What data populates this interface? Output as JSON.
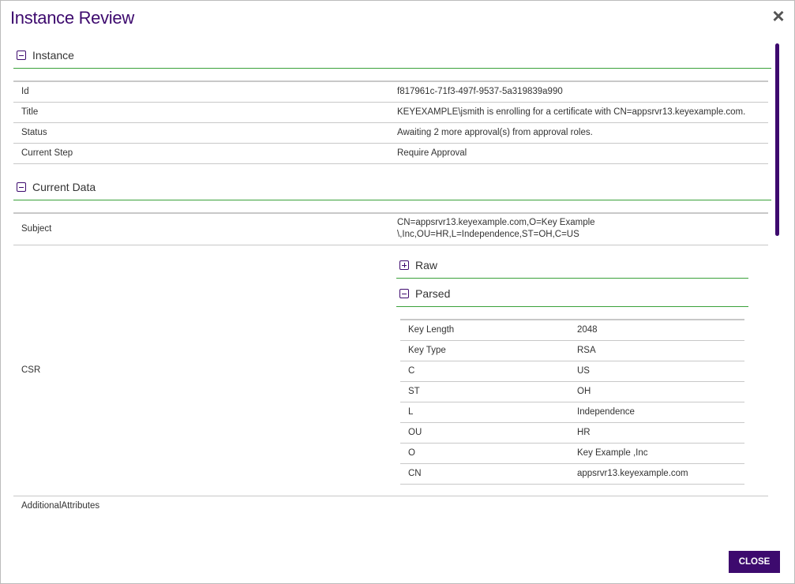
{
  "dialog": {
    "title": "Instance Review",
    "close_icon": "close-icon",
    "close_button": "CLOSE"
  },
  "instance": {
    "header": "Instance",
    "rows": [
      {
        "label": "Id",
        "value": "f817961c-71f3-497f-9537-5a319839a990"
      },
      {
        "label": "Title",
        "value": "KEYEXAMPLE\\jsmith is enrolling for a certificate with CN=appsrvr13.keyexample.com."
      },
      {
        "label": "Status",
        "value": "Awaiting 2 more approval(s) from approval roles."
      },
      {
        "label": "Current Step",
        "value": "Require Approval"
      }
    ]
  },
  "current_data": {
    "header": "Current Data",
    "subject": {
      "label": "Subject",
      "value_line1": "CN=appsrvr13.keyexample.com,O=Key Example",
      "value_line2": "\\,Inc,OU=HR,L=Independence,ST=OH,C=US"
    },
    "csr": {
      "label": "CSR",
      "raw_header": "Raw",
      "parsed_header": "Parsed",
      "parsed_rows": [
        {
          "label": "Key Length",
          "value": "2048"
        },
        {
          "label": "Key Type",
          "value": "RSA"
        },
        {
          "label": "C",
          "value": "US"
        },
        {
          "label": "ST",
          "value": "OH"
        },
        {
          "label": "L",
          "value": "Independence"
        },
        {
          "label": "OU",
          "value": "HR"
        },
        {
          "label": "O",
          "value": "Key Example ,Inc"
        },
        {
          "label": "CN",
          "value": "appsrvr13.keyexample.com"
        }
      ]
    },
    "additional_attributes": {
      "label": "AdditionalAttributes",
      "value": ""
    }
  },
  "colors": {
    "accent": "#3d0a6e",
    "section_line": "#3aa13a",
    "row_border": "#c8c8c8"
  }
}
